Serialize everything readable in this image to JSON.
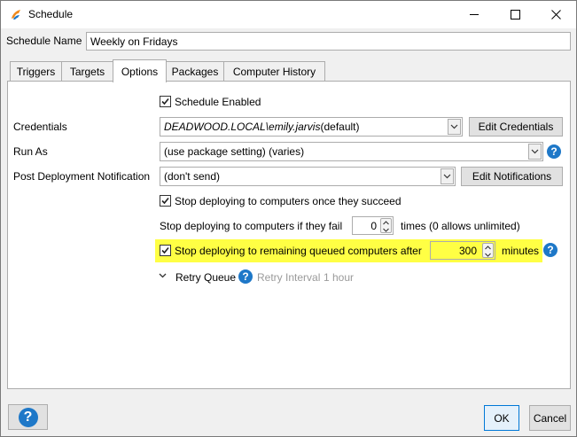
{
  "window": {
    "title": "Schedule",
    "icon": "schedule-app-icon",
    "controls": {
      "minimize": "minimize-icon",
      "maximize": "maximize-icon",
      "close": "close-icon"
    }
  },
  "schedule_name": {
    "label": "Schedule Name",
    "value": "Weekly on Fridays"
  },
  "tabs": [
    {
      "label": "Triggers",
      "active": false
    },
    {
      "label": "Targets",
      "active": false
    },
    {
      "label": "Options",
      "active": true
    },
    {
      "label": "Packages",
      "active": false
    },
    {
      "label": "Computer History",
      "active": false
    }
  ],
  "options": {
    "schedule_enabled": {
      "label": "Schedule Enabled",
      "checked": true
    },
    "credentials": {
      "label": "Credentials",
      "value_prefix": "DEADWOOD.LOCAL\\emily.jarvis",
      "value_suffix": " (default)",
      "button": "Edit Credentials"
    },
    "run_as": {
      "label": "Run As",
      "value": "(use package setting) (varies)"
    },
    "notification": {
      "label": "Post Deployment Notification",
      "value": "(don't send)",
      "button": "Edit Notifications"
    },
    "stop_on_success": {
      "label": "Stop deploying to computers once they succeed",
      "checked": true
    },
    "stop_on_fail": {
      "label": "Stop deploying to computers if they fail",
      "value": "0",
      "suffix": "times (0 allows unlimited)"
    },
    "stop_queued": {
      "label": "Stop deploying to remaining queued computers after",
      "checked": true,
      "value": "300",
      "suffix": "minutes",
      "highlight_color": "#ffff44"
    },
    "retry_queue": {
      "label": "Retry Queue",
      "interval_label": "Retry Interval",
      "interval_value": "1 hour"
    }
  },
  "footer": {
    "help": "?",
    "ok": "OK",
    "cancel": "Cancel"
  },
  "colors": {
    "accent": "#1e78c8",
    "highlight": "#ffff44"
  }
}
